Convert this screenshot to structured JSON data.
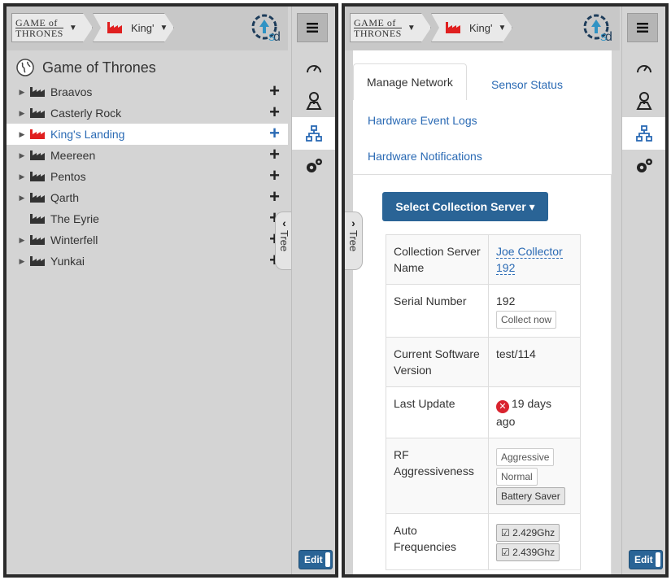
{
  "left": {
    "logo_line1": "GAME of",
    "logo_line2": "THRONES",
    "site_label": "King'",
    "tree_root": "Game of Thrones",
    "tree_items": [
      {
        "label": "Braavos",
        "has_children": true,
        "selected": false
      },
      {
        "label": "Casterly Rock",
        "has_children": true,
        "selected": false
      },
      {
        "label": "King's Landing",
        "has_children": true,
        "selected": true
      },
      {
        "label": "Meereen",
        "has_children": true,
        "selected": false
      },
      {
        "label": "Pentos",
        "has_children": true,
        "selected": false
      },
      {
        "label": "Qarth",
        "has_children": true,
        "selected": false
      },
      {
        "label": "The Eyrie",
        "has_children": false,
        "selected": false
      },
      {
        "label": "Winterfell",
        "has_children": true,
        "selected": false
      },
      {
        "label": "Yunkai",
        "has_children": true,
        "selected": false
      }
    ],
    "plus_symbol": "+",
    "tree_handle_label": "Tree",
    "edit_label": "Edit"
  },
  "right": {
    "logo_line1": "GAME of",
    "logo_line2": "THRONES",
    "site_label": "King'",
    "tabs": {
      "manage_network": "Manage Network",
      "sensor_status": "Sensor Status",
      "hardware_event_logs": "Hardware Event Logs",
      "hardware_notifications": "Hardware Notifications"
    },
    "select_button": "Select Collection Server ▾",
    "rows": {
      "server_name_key": "Collection Server Name",
      "server_name_value_l1": "Joe Collector",
      "server_name_value_l2": "192",
      "serial_key": "Serial Number",
      "serial_value": "192",
      "collect_now": "Collect now",
      "software_key": "Current Software Version",
      "software_value": "test/114",
      "last_update_key": "Last Update",
      "last_update_value": "19 days ago",
      "rf_key": "RF Aggressiveness",
      "rf_options": [
        "Aggressive",
        "Normal",
        "Battery Saver"
      ],
      "auto_freq_key": "Auto Frequencies",
      "freq1": "2.429Ghz",
      "freq2": "2.439Ghz"
    },
    "tree_handle_label": "Tree",
    "edit_label": "Edit"
  },
  "colors": {
    "accent": "#2a6496",
    "link": "#2a6ab4",
    "brand_red": "#e02020",
    "error": "#d9232e"
  }
}
